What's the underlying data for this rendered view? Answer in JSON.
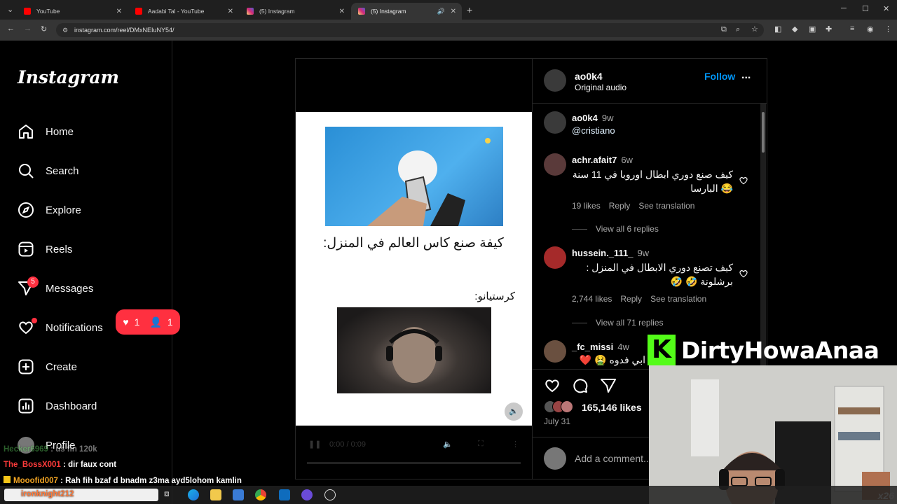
{
  "browser": {
    "tabs": [
      {
        "title": "YouTube",
        "icon": "youtube-icon"
      },
      {
        "title": "Aadabi Tal - YouTube",
        "icon": "youtube-icon"
      },
      {
        "title": "(5) Instagram",
        "icon": "instagram-icon"
      },
      {
        "title": "(5) Instagram",
        "icon": "instagram-icon"
      }
    ],
    "url": "instagram.com/reel/DMxNEIuNY54/"
  },
  "sidebar": {
    "logo": "Instagram",
    "items": [
      {
        "label": "Home",
        "icon": "home-icon"
      },
      {
        "label": "Search",
        "icon": "search-icon"
      },
      {
        "label": "Explore",
        "icon": "compass-icon"
      },
      {
        "label": "Reels",
        "icon": "reels-icon"
      },
      {
        "label": "Messages",
        "icon": "messenger-icon"
      },
      {
        "label": "Notifications",
        "icon": "heart-icon"
      },
      {
        "label": "Create",
        "icon": "plus-square-icon"
      },
      {
        "label": "Dashboard",
        "icon": "dashboard-icon"
      },
      {
        "label": "Profile",
        "icon": "avatar"
      }
    ],
    "messages_badge": "5",
    "notif_likes": "1",
    "notif_follows": "1"
  },
  "reel": {
    "caption_line1": "كيفة صنع كاس العالم في المنزل:",
    "caption_line2": "كرستيانو:",
    "time": "0:00 / 0:09"
  },
  "post": {
    "author": "ao0k4",
    "audio": "Original audio",
    "follow_label": "Follow",
    "more": "...",
    "caption_author": "ao0k4",
    "caption_time": "9w",
    "caption_mention": "@cristiano",
    "comments": [
      {
        "user": "achr.afait7",
        "time": "6w",
        "text": "كيف صنع دوري ابطال اوروبا في 11 سنة 😂 البارسا",
        "likes": "19 likes",
        "reply": "Reply",
        "translate": "See translation",
        "view_replies": "View all 6 replies"
      },
      {
        "user": "hussein._111_",
        "time": "9w",
        "text": "كيف تصنع دوري الابطال في المنزل : برشلونة 🤣 🤣",
        "likes": "2,744 likes",
        "reply": "Reply",
        "translate": "See translation",
        "view_replies": "View all 71 replies"
      },
      {
        "user": "_fc_missi",
        "time": "4w",
        "text": "ابي فدوه 🤮 ❤️"
      }
    ],
    "likes_count": "165,146 likes",
    "date": "July 31",
    "add_comment_placeholder": "Add a comment..."
  },
  "overlay": {
    "logo_letter": "K",
    "streamer_name": "DirtyHowaAnaa",
    "multiplier": "x26"
  },
  "chat": [
    {
      "user": "Hecker6969",
      "message": "us fin 120k"
    },
    {
      "user": "The_BossX001",
      "message": "dir faux cont"
    },
    {
      "user": "Mooofid007",
      "message": "Rah fih bzaf d bnadm z3ma ayd5lohom kamlin"
    },
    {
      "user": "ironknight212",
      "message": ""
    }
  ],
  "colors": {
    "accent_blue": "#0095f6",
    "mention_blue": "#e0f1ff",
    "notification_red": "#ff3040",
    "kick_green": "#53fc18"
  }
}
